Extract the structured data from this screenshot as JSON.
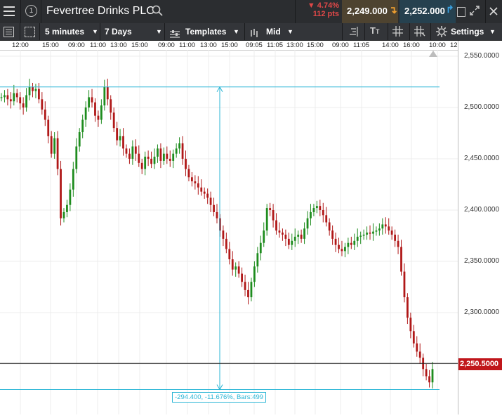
{
  "header": {
    "instrument_name": "Fevertree Drinks PLC",
    "change_percent": "▼ 4.74%",
    "change_points": "112 pts",
    "sell_price": "2,249.000",
    "buy_price": "2,252.000",
    "colors": {
      "down": "#e04848",
      "sell_bg": "#5a4a2a",
      "buy_bg": "#2c4a5a",
      "arrow_sell": "#f0a030",
      "arrow_buy": "#3aa0e0"
    }
  },
  "toolbar": {
    "interval": "5 minutes",
    "range": "7 Days",
    "templates_label": "Templates",
    "price_mode": "Mid",
    "settings_label": "Settings"
  },
  "time_axis": {
    "labels": [
      "12:00",
      "15:00",
      "09:00",
      "11:00",
      "13:00",
      "15:00",
      "09:00",
      "11:00",
      "13:00",
      "15:00",
      "09:05",
      "11:05",
      "13:00",
      "15:00",
      "09:00",
      "11:05",
      "14:00",
      "16:00",
      "10:00",
      "12:00"
    ]
  },
  "price_axis": {
    "labels": [
      "2,550.0000",
      "2,500.0000",
      "2,450.0000",
      "2,400.0000",
      "2,350.0000",
      "2,300.0000"
    ],
    "current_price_label": "2,250.5000",
    "current_color": "#c0161b"
  },
  "measure": {
    "label": "-294.400, -11.676%, Bars:499",
    "color": "#2bb6d6"
  },
  "chart_data": {
    "type": "candlestick",
    "y_range": [
      2200,
      2570
    ],
    "current_price": 2250.5,
    "measure_high": 2520,
    "measure_low": 2225,
    "series": [
      {
        "name": "",
        "values": [
          2510,
          2512,
          2508,
          2506,
          2514,
          2510,
          2504,
          2500,
          2512,
          2520,
          2516,
          2518,
          2508,
          2498,
          2488,
          2472,
          2455,
          2470,
          2440,
          2392,
          2398,
          2405,
          2420,
          2440,
          2462,
          2476,
          2488,
          2500,
          2510,
          2505,
          2492,
          2488,
          2502,
          2520,
          2508,
          2495,
          2480,
          2468,
          2472,
          2460,
          2455,
          2450,
          2462,
          2455,
          2446,
          2440,
          2452,
          2450,
          2445,
          2452,
          2460,
          2448,
          2455,
          2450,
          2448,
          2455,
          2460,
          2465,
          2450,
          2440,
          2432,
          2428,
          2426,
          2422,
          2418,
          2416,
          2412,
          2405,
          2398,
          2392,
          2380,
          2372,
          2362,
          2352,
          2342,
          2345,
          2338,
          2330,
          2322,
          2315,
          2330,
          2345,
          2358,
          2368,
          2380,
          2402,
          2400,
          2390,
          2380,
          2378,
          2376,
          2372,
          2366,
          2370,
          2374,
          2376,
          2372,
          2382,
          2392,
          2398,
          2402,
          2404,
          2400,
          2395,
          2388,
          2380,
          2372,
          2366,
          2362,
          2360,
          2364,
          2368,
          2366,
          2370,
          2374,
          2375,
          2376,
          2378,
          2377,
          2379,
          2380,
          2382,
          2386,
          2384,
          2380,
          2376,
          2370,
          2364,
          2340,
          2315,
          2295,
          2282,
          2270,
          2262,
          2256,
          2245,
          2238,
          2232,
          2245
        ]
      }
    ]
  }
}
